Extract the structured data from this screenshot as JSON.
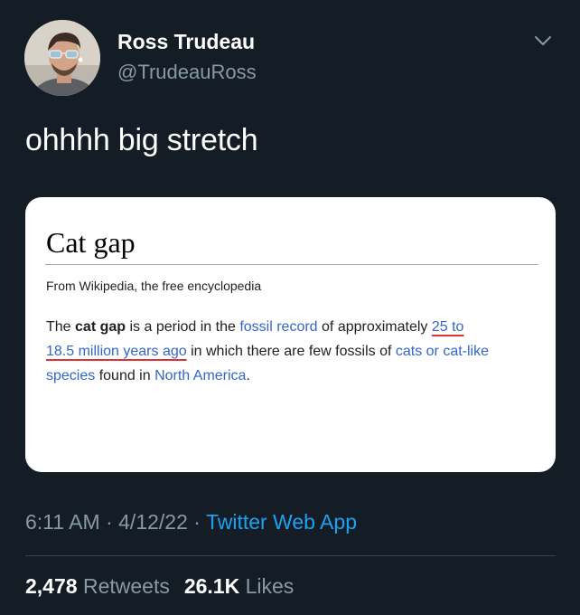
{
  "tweet": {
    "author_name": "Ross Trudeau",
    "author_handle": "@TrudeauRoss",
    "text": "ohhhh big stretch",
    "time": "6:11 AM",
    "date": "4/12/22",
    "separator": "·",
    "app": "Twitter Web App",
    "retweets_count": "2,478",
    "retweets_label": "Retweets",
    "likes_count": "26.1K",
    "likes_label": "Likes",
    "icons": {
      "avatar": "profile-photo",
      "menu": "chevron-down-icon"
    }
  },
  "wiki_card": {
    "title": "Cat gap",
    "subtitle": "From Wikipedia, the free encyclopedia",
    "t1": "The ",
    "t2": "cat gap",
    "t3": " is a period in the ",
    "link_fossil": "fossil record",
    "t4": " of approximately ",
    "link_range_a": "25 to",
    "link_range_b": "18.5 million years ago",
    "t5": " in which there are few fossils of ",
    "link_cats_a": "cats or cat-like",
    "link_cats_b": "species",
    "t6": " found in ",
    "link_na": "North America",
    "t7": "."
  },
  "colors": {
    "background": "#141d26",
    "secondary_text": "#8899a6",
    "link_blue": "#1da1f2",
    "wiki_link": "#3366cc",
    "underline_red": "#dd3333"
  }
}
